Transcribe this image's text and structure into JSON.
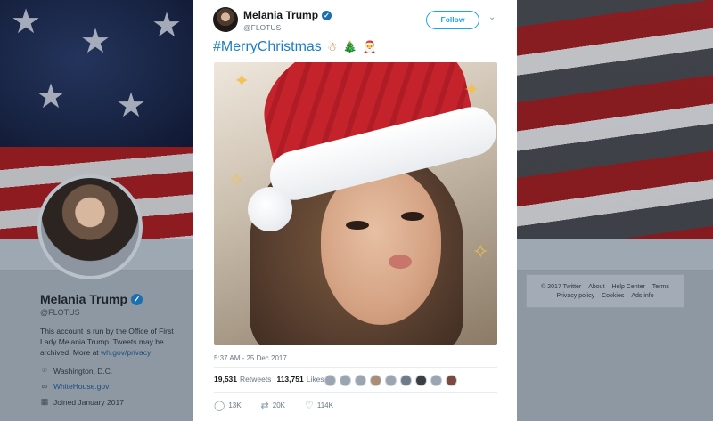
{
  "background": {
    "profile": {
      "name": "Melania Trump",
      "handle": "@FLOTUS",
      "bio": "This account is run by the Office of First Lady Melania Trump. Tweets may be archived. More at",
      "bio_link": "wh.gov/privacy",
      "location": "Washington, D.C.",
      "website": "WhiteHouse.gov",
      "joined": "Joined January 2017"
    },
    "footer": {
      "line1": [
        "© 2017 Twitter",
        "About",
        "Help Center",
        "Terms"
      ],
      "line2": [
        "Privacy policy",
        "Cookies",
        "Ads info"
      ]
    }
  },
  "tweet": {
    "author_name": "Melania Trump",
    "author_handle": "@FLOTUS",
    "verified_badge": "✓",
    "follow_label": "Follow",
    "caret": "⌄",
    "hashtag": "#MerryChristmas",
    "emojis": {
      "gingerbread": "☃",
      "tree": "🎄",
      "santa": "🎅"
    },
    "timestamp": "5:37 AM - 25 Dec 2017",
    "retweets_count": "19,531",
    "retweets_label": "Retweets",
    "likes_count": "113,751",
    "likes_label": "Likes",
    "liker_avatars": 9,
    "actions": {
      "reply_count": "13K",
      "retweet_count": "20K",
      "like_count": "114K"
    }
  },
  "icons": {
    "location": "location-pin-icon",
    "link": "link-icon",
    "calendar": "calendar-icon",
    "reply": "reply-icon",
    "retweet": "retweet-icon",
    "like": "heart-icon"
  },
  "colors": {
    "accent": "#1da1f2",
    "hashtag": "#1d7fc3",
    "verified": "#1b6fb0"
  }
}
